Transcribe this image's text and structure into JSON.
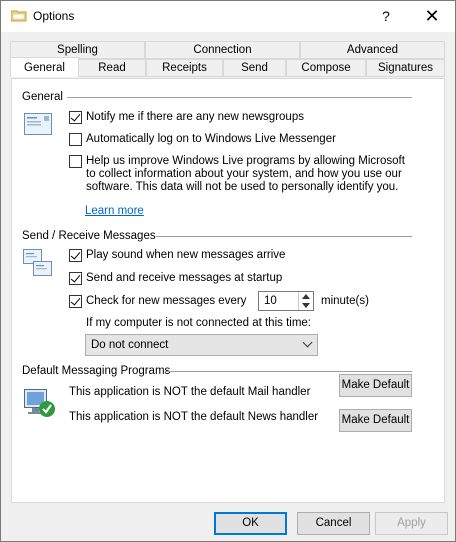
{
  "window": {
    "title": "Options",
    "help_glyph": "?",
    "close_glyph": "✕"
  },
  "tabs": {
    "row_back": [
      "Spelling",
      "Connection",
      "Advanced"
    ],
    "row_front": [
      "General",
      "Read",
      "Receipts",
      "Send",
      "Compose",
      "Signatures"
    ],
    "active": "General"
  },
  "general": {
    "heading": "General",
    "notify_label": "Notify me if there are any new newsgroups",
    "notify_checked": true,
    "autologon_label": "Automatically log on to Windows Live Messenger",
    "autologon_checked": false,
    "improve_text": "Help us improve Windows Live programs by allowing Microsoft to collect information about your system, and how you use our software. This data will not be used to personally identify you.",
    "improve_checked": false,
    "learn_more": "Learn more"
  },
  "send_receive": {
    "heading": "Send / Receive Messages",
    "play_sound_label": "Play sound when new messages arrive",
    "play_sound_checked": true,
    "startup_label": "Send and receive messages at startup",
    "startup_checked": true,
    "check_label": "Check for new messages every",
    "check_checked": true,
    "check_minutes": "10",
    "minutes_label": "minute(s)",
    "not_connected_label": "If my computer is not connected at this time:",
    "not_connected_value": "Do not connect"
  },
  "default_programs": {
    "heading": "Default Messaging Programs",
    "mail_text": "This application is NOT the default Mail handler",
    "news_text": "This application is NOT the default News handler",
    "make_default_label": "Make Default"
  },
  "footer": {
    "ok": "OK",
    "cancel": "Cancel",
    "apply": "Apply"
  }
}
